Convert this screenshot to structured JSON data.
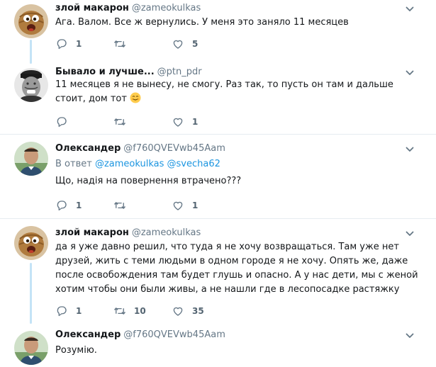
{
  "tweets": [
    {
      "name": "злой макарон",
      "handle": "@zameokulkas",
      "text": "Ага. Валом. Все ж вернулись. У меня это заняло 11 месяцев",
      "reply_count": "1",
      "retweet_count": "",
      "like_count": "5"
    },
    {
      "name": "Бывало и лучше...",
      "handle": "@ptn_pdr",
      "text": "11 месяцев я не вынесу, не смогу. Раз так, то пусть он там и дальше стоит, дом тот",
      "emoji": "smiling-face-icon",
      "reply_count": "",
      "retweet_count": "",
      "like_count": "1"
    },
    {
      "name": "Олександер",
      "handle": "@f760QVEVwb45Aam",
      "reply_prefix": "В ответ",
      "reply_handle_1": "@zameokulkas",
      "reply_handle_2": "@svecha62",
      "text": "Що, надія на повернення втрачено???",
      "reply_count": "1",
      "retweet_count": "",
      "like_count": "1"
    },
    {
      "name": "злой макарон",
      "handle": "@zameokulkas",
      "text": "да я уже давно решил, что туда я не хочу возвращаться. Там уже нет друзей, жить с теми людьми в одном городе я не хочу. Опять же, даже после освобождения там будет глушь и опасно. А у нас дети, мы с женой хотим чтобы они были живы, а не нашли где в лесопосадке растяжку",
      "reply_count": "1",
      "retweet_count": "10",
      "like_count": "35"
    },
    {
      "name": "Олександер",
      "handle": "@f760QVEVwb45Aam",
      "text": "Розумію."
    }
  ],
  "colors": {
    "accent": "#1b95e0",
    "thread_line": "#c4e3f6",
    "muted": "#657786",
    "divider": "#e6ecf0"
  }
}
